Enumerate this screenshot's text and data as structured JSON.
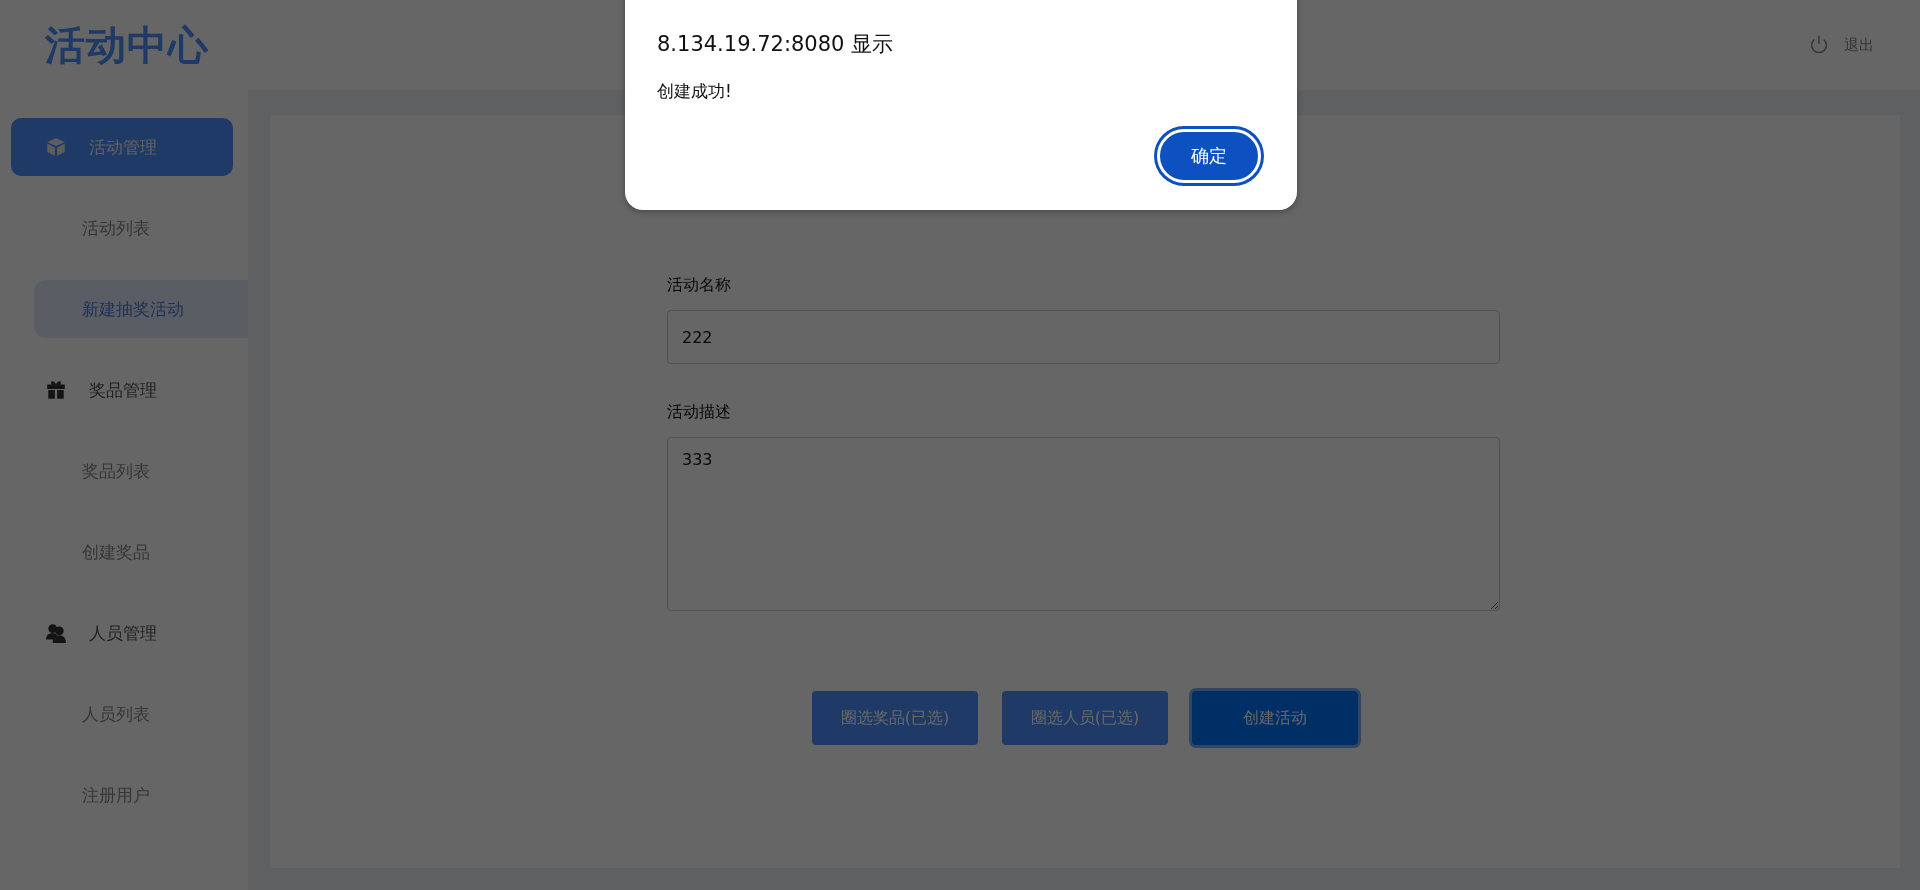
{
  "header": {
    "logo": "活动中心",
    "logout": "退出"
  },
  "sidebar": {
    "groups": [
      {
        "label": "活动管理",
        "kind": "box",
        "selected": true,
        "items": [
          {
            "label": "活动列表",
            "selected": false
          },
          {
            "label": "新建抽奖活动",
            "selected": true
          }
        ]
      },
      {
        "label": "奖品管理",
        "kind": "gift",
        "selected": false,
        "items": [
          {
            "label": "奖品列表",
            "selected": false
          },
          {
            "label": "创建奖品",
            "selected": false
          }
        ]
      },
      {
        "label": "人员管理",
        "kind": "users",
        "selected": false,
        "items": [
          {
            "label": "人员列表",
            "selected": false
          },
          {
            "label": "注册用户",
            "selected": false
          }
        ]
      }
    ]
  },
  "form": {
    "fields": [
      {
        "kind": "input",
        "label": "活动名称",
        "value": "222"
      },
      {
        "kind": "textarea",
        "label": "活动描述",
        "value": "333"
      }
    ],
    "buttons": [
      {
        "label": "圈选奖品(已选)",
        "kind": "secondary"
      },
      {
        "label": "圈选人员(已选)",
        "kind": "secondary"
      },
      {
        "label": "创建活动",
        "kind": "primary"
      }
    ]
  },
  "dialog": {
    "title": "8.134.19.72:8080 显示",
    "message": "创建成功!",
    "button": "确定"
  }
}
